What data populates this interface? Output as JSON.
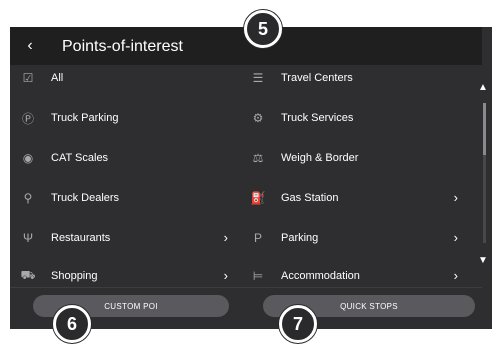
{
  "header": {
    "title": "Points-of-interest",
    "back_glyph": "‹"
  },
  "left_column": [
    {
      "label": "All",
      "icon": "checkbox-icon",
      "glyph": "☑",
      "chevron": false
    },
    {
      "label": "Truck Parking",
      "icon": "truck-parking-icon",
      "glyph": "Ⓟ",
      "chevron": false
    },
    {
      "label": "CAT Scales",
      "icon": "cat-scales-icon",
      "glyph": "◉",
      "chevron": false
    },
    {
      "label": "Truck Dealers",
      "icon": "truck-dealers-icon",
      "glyph": "⚲",
      "chevron": false
    },
    {
      "label": "Restaurants",
      "icon": "restaurant-icon",
      "glyph": "Ψ",
      "chevron": true
    },
    {
      "label": "Shopping",
      "icon": "shopping-cart-icon",
      "glyph": "⛟",
      "chevron": true
    }
  ],
  "right_column": [
    {
      "label": "Travel Centers",
      "icon": "travel-centers-icon",
      "glyph": "☰",
      "chevron": false
    },
    {
      "label": "Truck Services",
      "icon": "truck-services-icon",
      "glyph": "⚙",
      "chevron": false
    },
    {
      "label": "Weigh & Border",
      "icon": "weigh-border-icon",
      "glyph": "⚖",
      "chevron": false
    },
    {
      "label": "Gas Station",
      "icon": "gas-station-icon",
      "glyph": "⛽",
      "chevron": true
    },
    {
      "label": "Parking",
      "icon": "parking-icon",
      "glyph": "P",
      "chevron": true
    },
    {
      "label": "Accommodation",
      "icon": "bed-icon",
      "glyph": "⊨",
      "chevron": true
    }
  ],
  "chevron_glyph": "›",
  "scroll": {
    "up_glyph": "▲",
    "down_glyph": "▼"
  },
  "buttons": {
    "custom_poi": "CUSTOM POI",
    "quick_stops": "QUICK STOPS"
  },
  "callouts": {
    "c5": "5",
    "c6": "6",
    "c7": "7"
  }
}
